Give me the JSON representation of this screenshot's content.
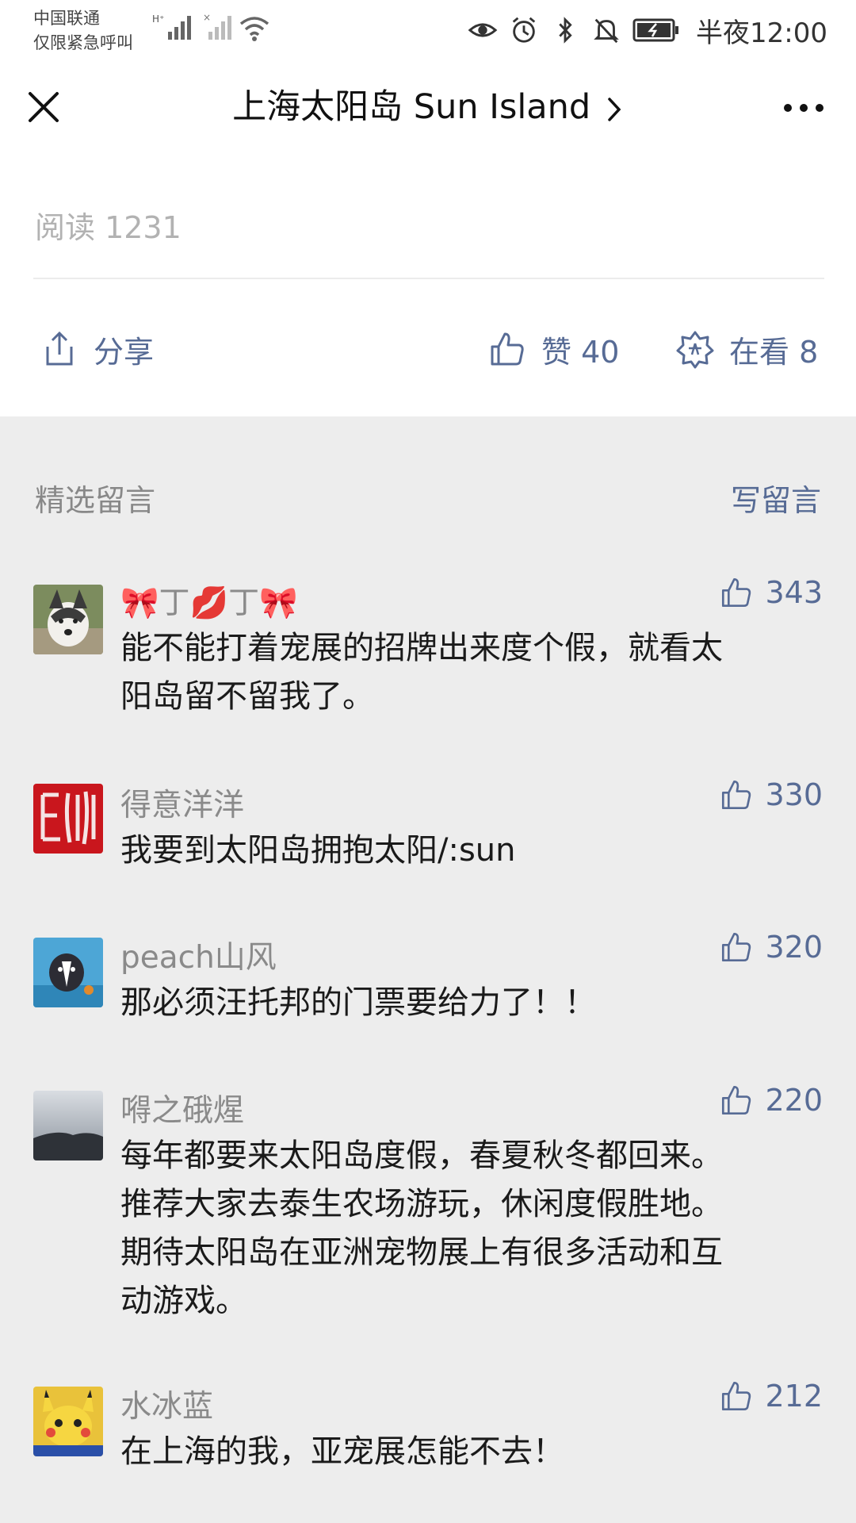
{
  "status_bar": {
    "carrier_line1": "中国联通",
    "carrier_line2": "仅限紧急呼叫",
    "network_label": "H⁺",
    "time": "半夜12:00",
    "icons": [
      "signal-icon",
      "wifi-icon",
      "eye-icon",
      "alarm-icon",
      "bluetooth-icon",
      "mute-icon",
      "battery-icon"
    ]
  },
  "navbar": {
    "title": "上海太阳岛 Sun Island"
  },
  "article": {
    "read_count": "阅读 1231"
  },
  "actions": {
    "share": "分享",
    "like": "赞 40",
    "wow": "在看 8"
  },
  "comments": {
    "section_title": "精选留言",
    "write_label": "写留言",
    "items": [
      {
        "name": "🎀丁💋丁🎀",
        "likes": "343",
        "lines": [
          "能不能打着宠展的招牌出来度个假，就看太",
          "阳岛留不留我了。"
        ]
      },
      {
        "name": "得意洋洋",
        "likes": "330",
        "lines": [
          "我要到太阳岛拥抱太阳/:sun"
        ]
      },
      {
        "name": "peach山风",
        "likes": "320",
        "lines": [
          "那必须汪托邦的门票要给力了！！"
        ]
      },
      {
        "name": "嘚之硪煋",
        "likes": "220",
        "lines": [
          "每年都要来太阳岛度假，春夏秋冬都回来。",
          "推荐大家去泰生农场游玩，休闲度假胜地。",
          "期待太阳岛在亚洲宠物展上有很多活动和互",
          "动游戏。"
        ]
      },
      {
        "name": "水冰蓝",
        "likes": "212",
        "lines": [
          "在上海的我，亚宠展怎能不去！"
        ]
      }
    ]
  },
  "colors": {
    "link_blue": "#576b95",
    "page_gray": "#ededed",
    "panel_white": "#ffffff"
  }
}
